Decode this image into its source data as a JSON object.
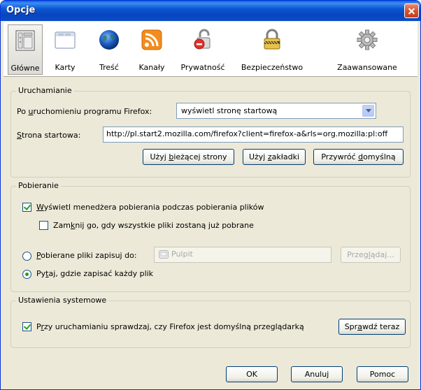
{
  "window": {
    "title": "Opcje"
  },
  "tabs": [
    {
      "label": "Główne",
      "icon": "general-icon",
      "selected": true
    },
    {
      "label": "Karty",
      "icon": "tabs-icon"
    },
    {
      "label": "Treść",
      "icon": "content-globe-icon"
    },
    {
      "label": "Kanały",
      "icon": "feed-icon"
    },
    {
      "label": "Prywatność",
      "icon": "privacy-icon"
    },
    {
      "label": "Bezpieczeństwo",
      "icon": "lock-icon"
    },
    {
      "label": "Zaawansowane",
      "icon": "gear-icon"
    }
  ],
  "startup": {
    "title": "Uruchamianie",
    "when_label": "Po uruchomieniu programu Firefox:",
    "when_value": "wyświetl stronę startową",
    "home_label": "Strona startowa:",
    "home_value": "http://pl.start2.mozilla.com/firefox?client=firefox-a&rls=org.mozilla:pl:off",
    "use_current": "Użyj bieżącej strony",
    "use_bookmark": "Użyj zakładki",
    "restore_default": "Przywróć domyślną"
  },
  "downloads": {
    "title": "Pobieranie",
    "show_manager": "Wyświetl menedżera pobierania podczas pobierania plików",
    "show_manager_checked": true,
    "close_when_done": "Zamknij go, gdy wszystkie pliki zostaną już pobrane",
    "close_when_done_checked": false,
    "save_to_label": "Pobierane pliki zapisuj do:",
    "save_to_value": "Pulpit",
    "browse": "Przeglądaj...",
    "ask_label": "Pytaj, gdzie zapisać każdy plik",
    "selected_option": "ask"
  },
  "system": {
    "title": "Ustawienia systemowe",
    "check_default": "Przy uruchamianiu sprawdzaj, czy Firefox jest domyślną przeglądarką",
    "check_default_checked": true,
    "check_now": "Sprawdź teraz"
  },
  "footer": {
    "ok": "OK",
    "cancel": "Anuluj",
    "help": "Pomoc"
  },
  "colors": {
    "titlebar": "#0a4bc7",
    "dialog_bg": "#ece9d8",
    "check_mark": "#21a121"
  }
}
